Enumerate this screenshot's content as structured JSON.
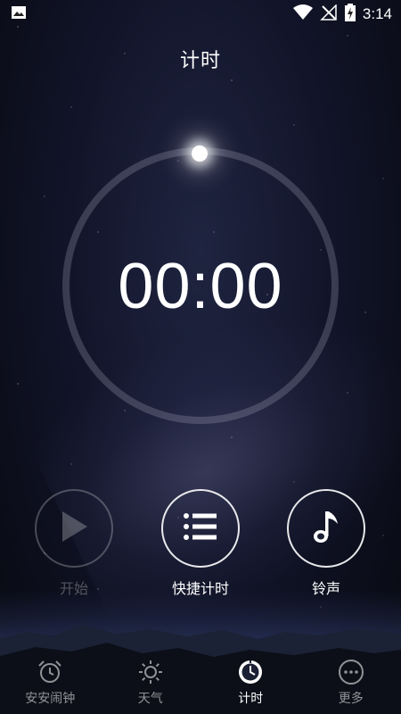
{
  "status_bar": {
    "time": "3:14",
    "icons": [
      "image-icon",
      "wifi-icon",
      "no-signal-icon",
      "battery-charging-icon"
    ]
  },
  "header": {
    "title": "计时"
  },
  "timer": {
    "display": "00:00"
  },
  "controls": {
    "start": {
      "label": "开始",
      "icon": "play-icon",
      "enabled": false
    },
    "quick_timer": {
      "label": "快捷计时",
      "icon": "list-icon"
    },
    "ringtone": {
      "label": "铃声",
      "icon": "music-note-icon"
    }
  },
  "bottom_nav": {
    "items": [
      {
        "label": "安安闹钟",
        "icon": "alarm-clock-icon",
        "active": false
      },
      {
        "label": "天气",
        "icon": "sun-icon",
        "active": false
      },
      {
        "label": "计时",
        "icon": "timer-icon",
        "active": true
      },
      {
        "label": "更多",
        "icon": "more-icon",
        "active": false
      }
    ]
  }
}
